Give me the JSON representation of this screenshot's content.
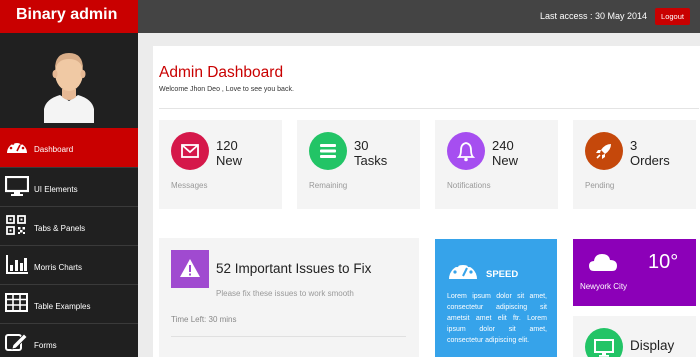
{
  "header": {
    "brand": "Binary admin",
    "last_access": "Last access : 30 May 2014",
    "logout_label": "Logout"
  },
  "sidebar": {
    "items": [
      {
        "label": "Dashboard",
        "icon": "dashboard-icon",
        "active": true
      },
      {
        "label": "UI Elements",
        "icon": "desktop-icon"
      },
      {
        "label": "Tabs & Panels",
        "icon": "qrcode-icon"
      },
      {
        "label": "Morris Charts",
        "icon": "bar-chart-icon"
      },
      {
        "label": "Table Examples",
        "icon": "table-icon"
      },
      {
        "label": "Forms",
        "icon": "edit-icon"
      }
    ]
  },
  "main": {
    "title": "Admin Dashboard",
    "welcome": "Welcome Jhon Deo , Love to see you back.",
    "stats": [
      {
        "number": "120",
        "word": "New",
        "caption": "Messages",
        "icon": "envelope-icon",
        "color": "#d5184a"
      },
      {
        "number": "30",
        "word": "Tasks",
        "caption": "Remaining",
        "icon": "bars-icon",
        "color": "#22c466"
      },
      {
        "number": "240",
        "word": "New",
        "caption": "Notifications",
        "icon": "bell-icon",
        "color": "#a64ef0"
      },
      {
        "number": "3",
        "word": "Orders",
        "caption": "Pending",
        "icon": "rocket-icon",
        "color": "#c5480b"
      }
    ],
    "issues": {
      "title": "52 Important Issues to Fix",
      "subtitle": "Please fix these issues to work smooth",
      "time_left": "Time Left: 30 mins",
      "icon": "warning-icon",
      "color": "#a04ad0"
    },
    "speed": {
      "label": "SPEED",
      "text": "Lorem ipsum dolor sit amet, consectetur adipiscing sit ametsit amet elit ftr. Lorem ipsum dolor sit amet, consectetur adipiscing elit.",
      "icon": "dashboard-icon",
      "color": "#36a3ea"
    },
    "weather": {
      "city": "Newyork City",
      "temp": "10°",
      "icon": "cloud-icon",
      "color": "#8c00b8"
    },
    "display": {
      "label": "Display",
      "icon": "desktop-icon",
      "color": "#22c466"
    }
  },
  "colors": {
    "accent": "#c90000",
    "topbar": "#444444",
    "sidebar": "#202020"
  }
}
